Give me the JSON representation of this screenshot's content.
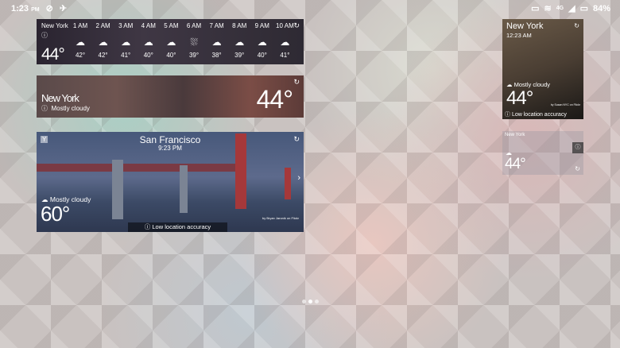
{
  "status_bar": {
    "time": "1:23",
    "ampm": "PM",
    "network": "4G",
    "battery": "84%"
  },
  "hourly_widget": {
    "city": "New York",
    "current_temp": "44°",
    "hours": [
      {
        "time": "1 AM",
        "icon": "cloud-icon",
        "temp": "42°"
      },
      {
        "time": "2 AM",
        "icon": "cloud-icon",
        "temp": "42°"
      },
      {
        "time": "3 AM",
        "icon": "cloud-icon",
        "temp": "41°"
      },
      {
        "time": "4 AM",
        "icon": "cloud-icon",
        "temp": "40°"
      },
      {
        "time": "5 AM",
        "icon": "cloud-icon",
        "temp": "40°"
      },
      {
        "time": "6 AM",
        "icon": "rain-cloud-icon",
        "temp": "39°"
      },
      {
        "time": "7 AM",
        "icon": "snow-cloud-icon",
        "temp": "38°"
      },
      {
        "time": "8 AM",
        "icon": "cloud-icon",
        "temp": "39°"
      },
      {
        "time": "9 AM",
        "icon": "cloud-icon",
        "temp": "40°"
      },
      {
        "time": "10 AM",
        "icon": "cloud-icon",
        "temp": "41°"
      }
    ]
  },
  "wide_widget": {
    "city": "New York",
    "condition": "Mostly cloudy",
    "temp": "44°"
  },
  "large_widget": {
    "city": "San Francisco",
    "time": "9:23 PM",
    "condition": "Mostly cloudy",
    "temp": "60°",
    "warning": "Low location accuracy",
    "credit": "by Bryan Jaronik on Flickr"
  },
  "tall_widget": {
    "city": "New York",
    "time": "12:23 AM",
    "condition": "Mostly cloudy",
    "temp": "44°",
    "warning": "Low location accuracy",
    "credit": "by Susan NYC on Flickr"
  },
  "small_widget": {
    "city": "New York",
    "temp": "44°"
  }
}
